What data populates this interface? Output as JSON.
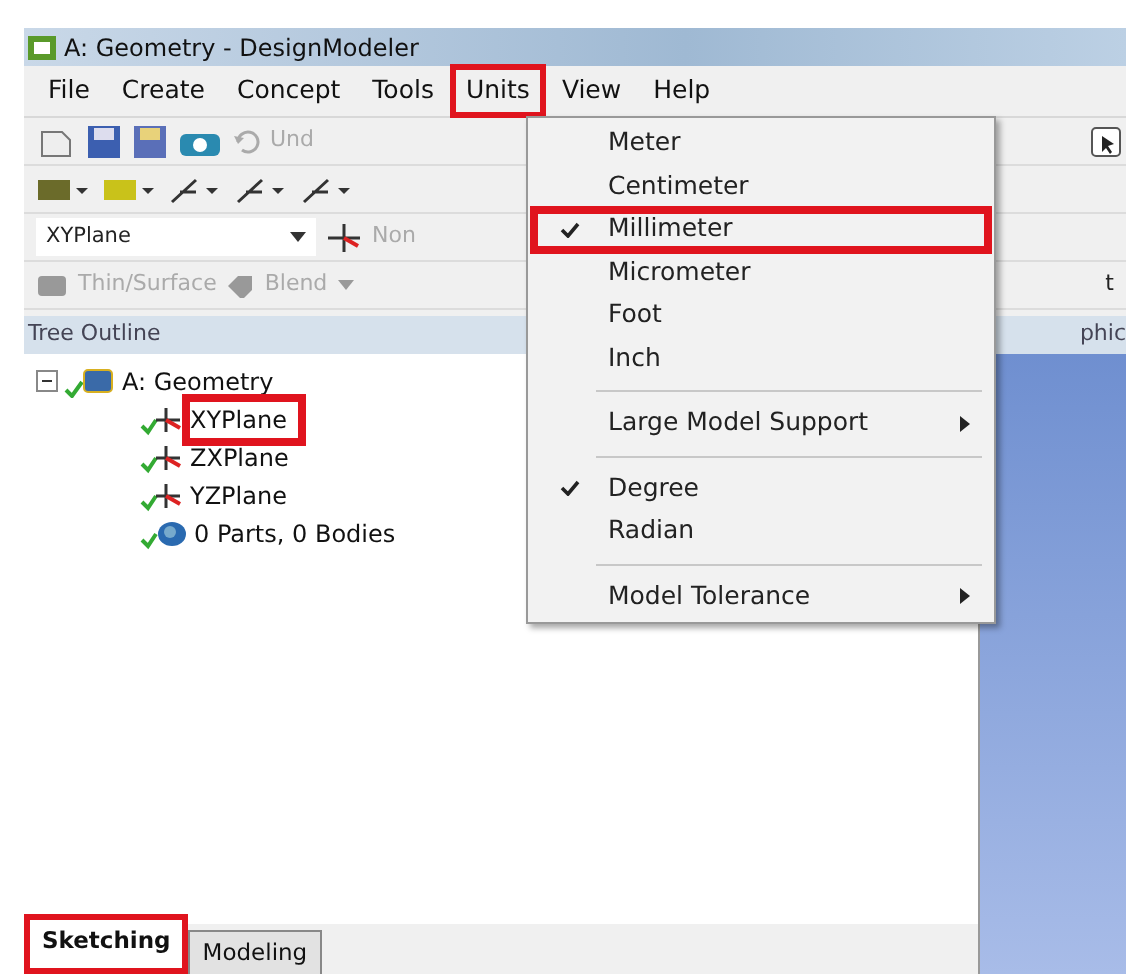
{
  "window": {
    "title": "A: Geometry - DesignModeler"
  },
  "menu_bar": [
    {
      "label": "File",
      "highlighted": false
    },
    {
      "label": "Create",
      "highlighted": false
    },
    {
      "label": "Concept",
      "highlighted": false
    },
    {
      "label": "Tools",
      "highlighted": false
    },
    {
      "label": "Units",
      "highlighted": true
    },
    {
      "label": "View",
      "highlighted": false
    },
    {
      "label": "Help",
      "highlighted": false
    }
  ],
  "toolbar": {
    "undo_label": "Und",
    "plane_select": "XYPlane",
    "none_label": "Non",
    "thin_surface": "Thin/Surface",
    "blend": "Blend",
    "right_cut_label": "t"
  },
  "units_menu": [
    {
      "kind": "item",
      "label": "Meter",
      "checked": false,
      "highlighted": false
    },
    {
      "kind": "item",
      "label": "Centimeter",
      "checked": false,
      "highlighted": false
    },
    {
      "kind": "item",
      "label": "Millimeter",
      "checked": true,
      "highlighted": true
    },
    {
      "kind": "item",
      "label": "Micrometer",
      "checked": false,
      "highlighted": false
    },
    {
      "kind": "item",
      "label": "Foot",
      "checked": false,
      "highlighted": false
    },
    {
      "kind": "item",
      "label": "Inch",
      "checked": false,
      "highlighted": false
    },
    {
      "kind": "separator"
    },
    {
      "kind": "submenu",
      "label": "Large Model Support",
      "checked": false,
      "highlighted": false
    },
    {
      "kind": "separator"
    },
    {
      "kind": "item",
      "label": "Degree",
      "checked": true,
      "highlighted": false
    },
    {
      "kind": "item",
      "label": "Radian",
      "checked": false,
      "highlighted": false
    },
    {
      "kind": "separator"
    },
    {
      "kind": "submenu",
      "label": "Model Tolerance",
      "checked": false,
      "highlighted": false
    }
  ],
  "tree_outline": {
    "title": "Tree Outline",
    "items": [
      {
        "label": "A: Geometry",
        "kind": "geometry",
        "expanded": true,
        "highlighted": false,
        "children": [
          {
            "label": "XYPlane",
            "kind": "plane",
            "highlighted": true
          },
          {
            "label": "ZXPlane",
            "kind": "plane",
            "highlighted": false
          },
          {
            "label": "YZPlane",
            "kind": "plane",
            "highlighted": false
          },
          {
            "label": "0 Parts, 0 Bodies",
            "kind": "bodies",
            "highlighted": false
          }
        ]
      }
    ]
  },
  "graphics_header": "phic",
  "bottom_tabs": [
    {
      "label": "Sketching",
      "selected": true,
      "highlighted": true
    },
    {
      "label": "Modeling",
      "selected": false,
      "highlighted": false
    }
  ]
}
